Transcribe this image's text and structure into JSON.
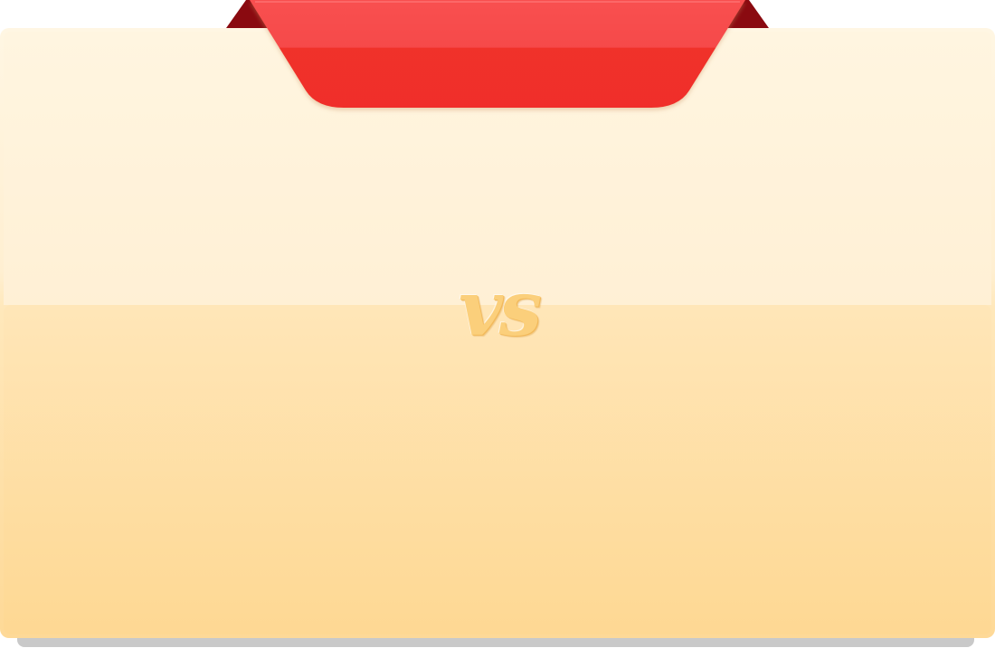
{
  "versus": {
    "label": "vs"
  },
  "colors": {
    "ribbon_top": "#f64a4a",
    "ribbon_bottom": "#f02f29",
    "ribbon_fold": "#8b0a10",
    "card_top": "#fff6e3",
    "card_bottom": "#fed997",
    "vs_text": "#fbcf7b",
    "card_shadow": "#c9c9c9"
  },
  "icons": {
    "ribbon": "red-banner-ribbon"
  }
}
